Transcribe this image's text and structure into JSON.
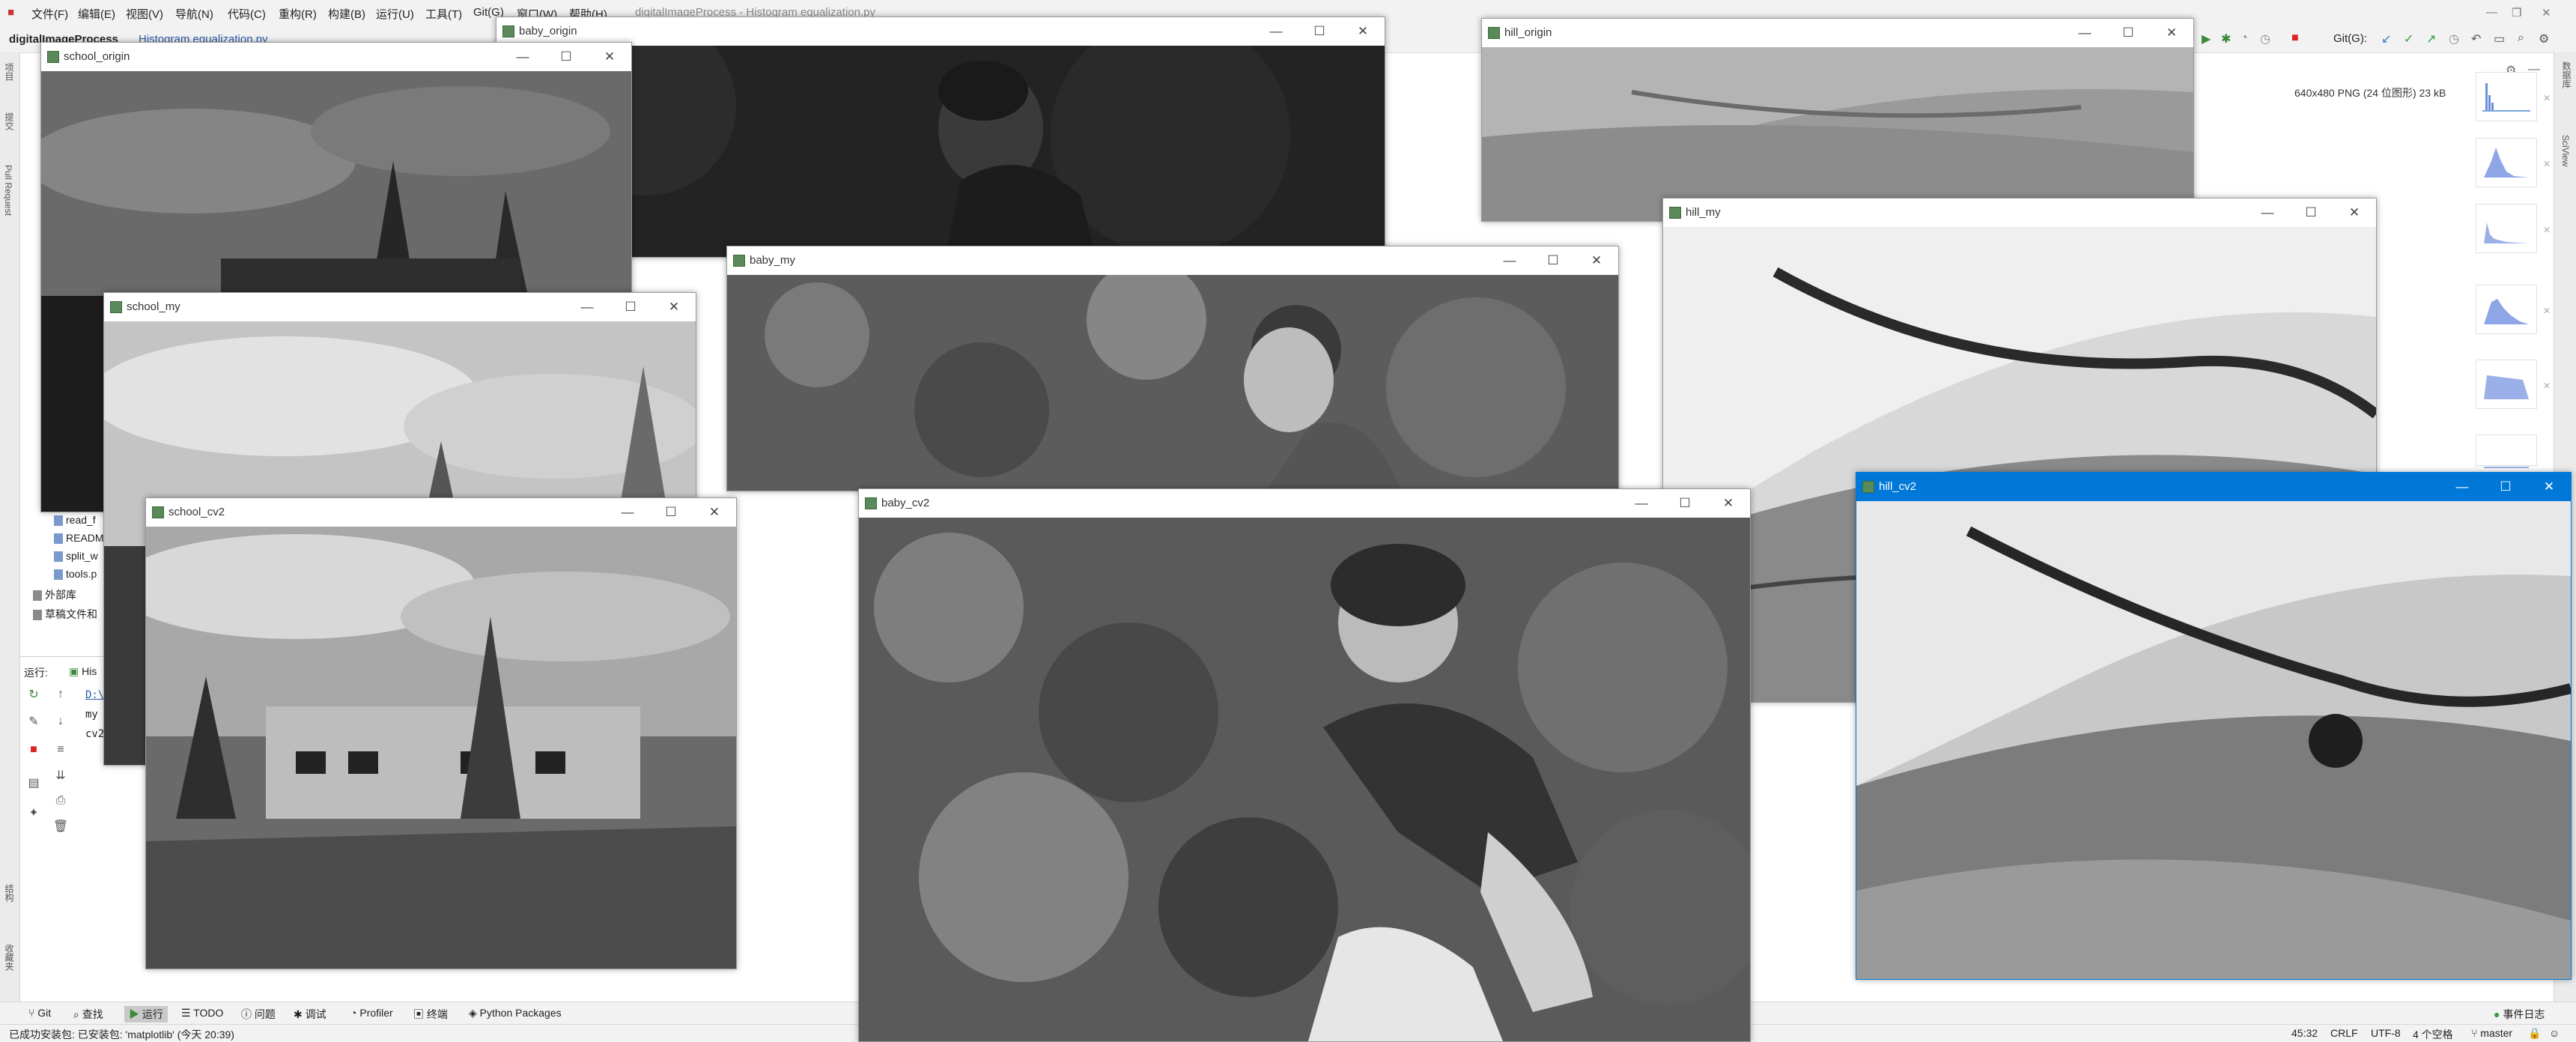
{
  "ide": {
    "menu": [
      "文件(F)",
      "编辑(E)",
      "视图(V)",
      "导航(N)",
      "代码(C)",
      "重构(R)",
      "构建(B)",
      "运行(U)",
      "工具(T)",
      "Git(G)",
      "窗口(W)",
      "帮助(H)"
    ],
    "title": "digitalImageProcess - Histogram equalization.py",
    "project_name": "digitalImageProcess",
    "file_tab": "Histogram equalization.py",
    "git_label": "Git(G):",
    "image_info": "640x480 PNG (24 位图形) 23 kB",
    "left_vertical_labels": [
      "项目",
      "提交",
      "Pull Request",
      "结构",
      "收藏夹"
    ],
    "right_vertical_labels": [
      "数据库",
      "SciView"
    ],
    "project_tree": [
      "read_f",
      "READM",
      "split_w",
      "tools.p",
      "外部库",
      "草稿文件和"
    ],
    "run_label": "运行:",
    "run_tab": "His",
    "run_output": [
      "D:\\",
      "my",
      "cv2"
    ]
  },
  "bottom_tools": [
    "Git",
    "查找",
    "运行",
    "TODO",
    "问题",
    "调试",
    "Profiler",
    "终端",
    "Python Packages"
  ],
  "status": {
    "message": "已成功安装包: 已安装包: 'matplotlib' (今天 20:39)",
    "position": "45:32",
    "line_ending": "CRLF",
    "encoding": "UTF-8",
    "indent": "4 个空格",
    "branch": "master",
    "event_log": "事件日志"
  },
  "windows": [
    {
      "id": "school_origin",
      "title": "school_origin"
    },
    {
      "id": "baby_origin",
      "title": "baby_origin"
    },
    {
      "id": "hill_origin",
      "title": "hill_origin"
    },
    {
      "id": "school_my",
      "title": "school_my"
    },
    {
      "id": "baby_my",
      "title": "baby_my"
    },
    {
      "id": "hill_my",
      "title": "hill_my"
    },
    {
      "id": "school_cv2",
      "title": "school_cv2"
    },
    {
      "id": "baby_cv2",
      "title": "baby_cv2"
    },
    {
      "id": "hill_cv2",
      "title": "hill_cv2"
    }
  ],
  "window_controls": {
    "minimize": "—",
    "maximize": "☐",
    "close": "✕"
  }
}
